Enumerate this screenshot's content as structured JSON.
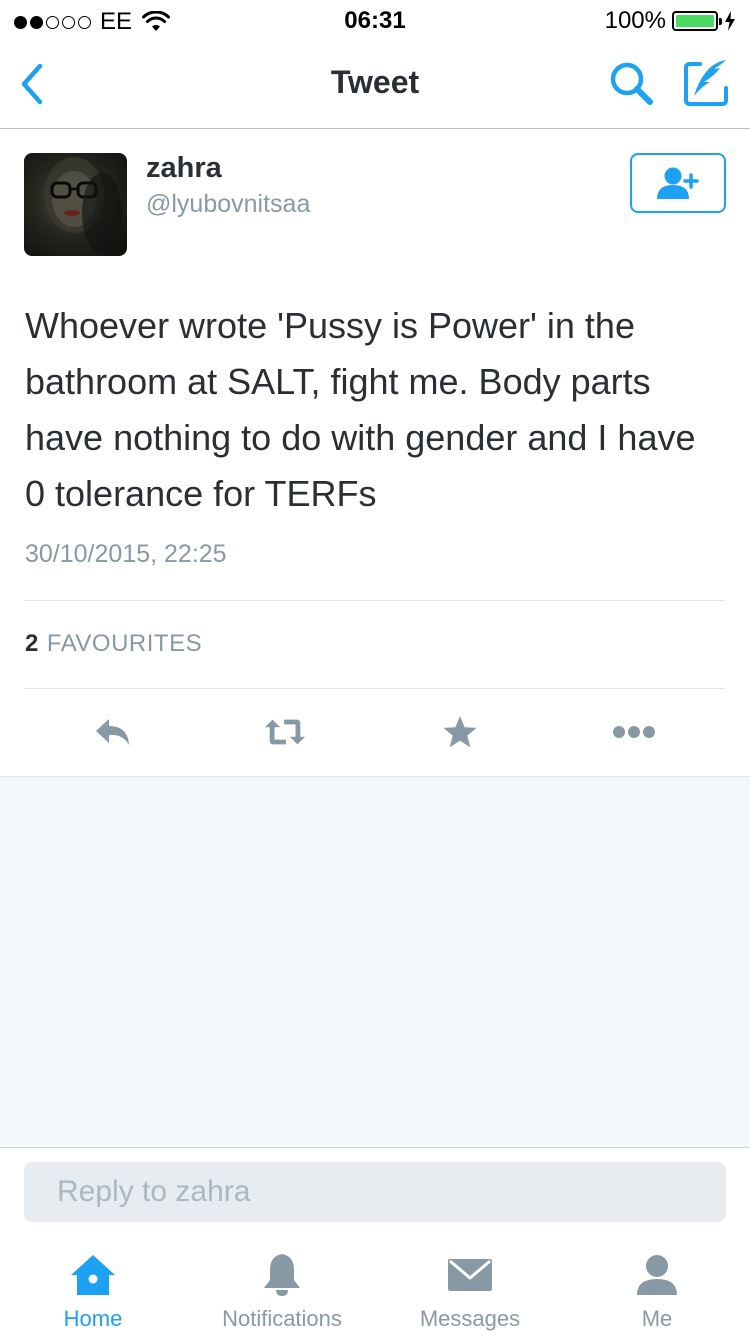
{
  "status_bar": {
    "carrier": "EE",
    "time": "06:31",
    "battery_percent": "100%",
    "signal_bars_filled": 2,
    "signal_bars_total": 5
  },
  "nav": {
    "title": "Tweet",
    "back_icon": "chevron-left-icon",
    "search_icon": "search-icon",
    "compose_icon": "compose-icon"
  },
  "tweet": {
    "user_name": "zahra",
    "user_handle": "@lyubovnitsaa",
    "text": "Whoever wrote 'Pussy is Power' in the bathroom at SALT, fight me. Body parts have nothing to do with gender and I have 0 tolerance for TERFs",
    "timestamp": "30/10/2015, 22:25",
    "favourites_count": "2",
    "favourites_label": "FAVOURITES"
  },
  "actions": [
    {
      "icon": "reply-icon"
    },
    {
      "icon": "retweet-icon"
    },
    {
      "icon": "star-icon"
    },
    {
      "icon": "more-icon"
    }
  ],
  "reply": {
    "placeholder": "Reply to zahra"
  },
  "tabbar": [
    {
      "label": "Home",
      "icon": "home-icon",
      "active": true
    },
    {
      "label": "Notifications",
      "icon": "bell-icon",
      "active": false
    },
    {
      "label": "Messages",
      "icon": "envelope-icon",
      "active": false
    },
    {
      "label": "Me",
      "icon": "person-icon",
      "active": false
    }
  ],
  "colors": {
    "accent": "#1da1f2",
    "icon_gray": "#8899a6",
    "text_dark": "#292f33",
    "battery_green": "#4cd964",
    "background_light": "#f5f8fa"
  }
}
